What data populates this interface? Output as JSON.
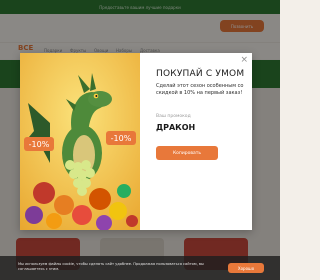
{
  "topbar": {
    "text": "Предоставьте вашим лучшие подарки"
  },
  "header": {
    "cta_label": "Позвонить"
  },
  "nav": {
    "logo": "ВСЕ",
    "links": [
      "Подарки",
      "Фрукты",
      "Овощи",
      "Наборы",
      "Доставка"
    ]
  },
  "modal": {
    "title": "ПОКУПАЙ С УМОМ",
    "description": "Сделай этот сезон особенным со скидкой в 10% на первый заказ!",
    "promo_label": "Ваш промокод",
    "promo_code": "ДРАКОН",
    "copy_button": "Копировать",
    "close_icon": "×",
    "badge_left": "-10%",
    "badge_right": "-10%"
  },
  "cookie": {
    "text": "Мы используем файлы cookie, чтобы сделать сайт удобнее. Продолжая пользоваться сайтом, вы соглашаетесь с этим.",
    "accept": "Хорошо"
  },
  "colors": {
    "accent": "#e8783a",
    "green": "#2f7a33"
  }
}
